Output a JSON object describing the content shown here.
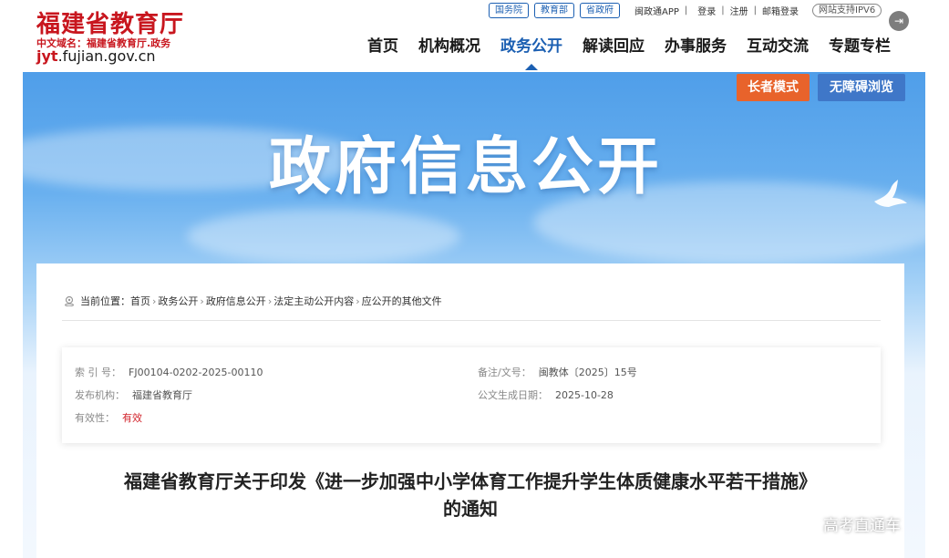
{
  "logo": {
    "name": "福建省教育厅",
    "domain_label": "中文域名：福建省教育厅.政务",
    "url_prefix": "jyt",
    "url_suffix": ".fujian.gov.cn"
  },
  "top_links": {
    "pills": [
      "国务院",
      "教育部",
      "省政府"
    ],
    "app": "闽政通APP",
    "login": "登录",
    "register": "注册",
    "mail_login": "邮箱登录",
    "ipv6": "网站支持IPV6"
  },
  "nav": {
    "items": [
      "首页",
      "机构概况",
      "政务公开",
      "解读回应",
      "办事服务",
      "互动交流",
      "专题专栏"
    ],
    "active_index": 2
  },
  "banner": {
    "title": "政府信息公开",
    "elder_mode": "长者模式",
    "accessible": "无障碍浏览"
  },
  "breadcrumb": {
    "label": "当前位置：",
    "items": [
      "首页",
      "政务公开",
      "政府信息公开",
      "法定主动公开内容",
      "应公开的其他文件"
    ]
  },
  "meta": {
    "index_key": "索 引 号：",
    "index_val": "FJ00104-0202-2025-00110",
    "docno_key": "备注/文号：",
    "docno_val": "闽教体〔2025〕15号",
    "issuer_key": "发布机构：",
    "issuer_val": "福建省教育厅",
    "date_key": "公文生成日期：",
    "date_val": "2025-10-28",
    "valid_key": "有效性：",
    "valid_val": "有效"
  },
  "doc": {
    "title_line1": "福建省教育厅关于印发《进一步加强中小学体育工作提升学生体质健康水平若干措施》",
    "title_line2": "的通知"
  },
  "watermark": "高考直通车",
  "colors": {
    "brand_red": "#c8161e",
    "nav_blue": "#1b5fb2",
    "elder_orange": "#e8632b",
    "access_blue": "#3f77c8",
    "valid_red": "#d1222a"
  }
}
